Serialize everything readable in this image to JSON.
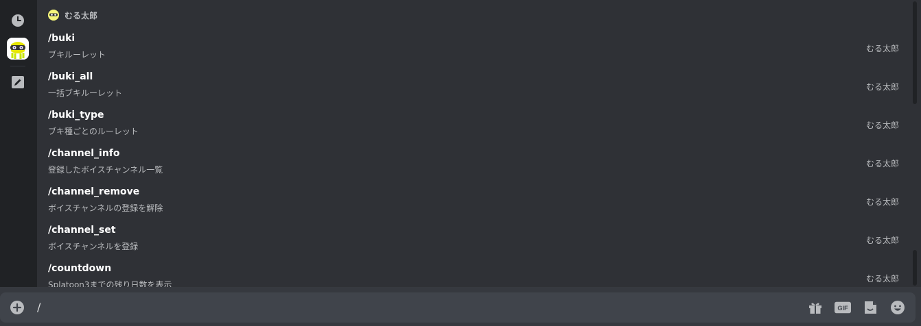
{
  "picker": {
    "section": {
      "bot_name": "むる太郎"
    },
    "commands": [
      {
        "name": "/buki",
        "description": "ブキルーレット",
        "source": "むる太郎"
      },
      {
        "name": "/buki_all",
        "description": "一括ブキルーレット",
        "source": "むる太郎"
      },
      {
        "name": "/buki_type",
        "description": "ブキ種ごとのルーレット",
        "source": "むる太郎"
      },
      {
        "name": "/channel_info",
        "description": "登録したボイスチャンネル一覧",
        "source": "むる太郎"
      },
      {
        "name": "/channel_remove",
        "description": "ボイスチャンネルの登録を解除",
        "source": "むる太郎"
      },
      {
        "name": "/channel_set",
        "description": "ボイスチャンネルを登録",
        "source": "むる太郎"
      },
      {
        "name": "/countdown",
        "description": "Splatoon3までの残り日数を表示",
        "source": "むる太郎"
      }
    ],
    "rail": {
      "recent_icon": "clock-icon",
      "bot_icon": "bot-avatar",
      "builtin_icon": "edit-icon"
    }
  },
  "composer": {
    "input_text": "/",
    "icons": [
      "gift-icon",
      "gif-icon",
      "sticker-icon",
      "emoji-icon"
    ],
    "gif_label": "GIF"
  },
  "colors": {
    "background": "#36393f",
    "picker_bg": "#2f3136",
    "rail_bg": "#202225",
    "composer_bg": "#40444b",
    "text_primary": "#ffffff",
    "text_muted": "#b9bbbe"
  }
}
